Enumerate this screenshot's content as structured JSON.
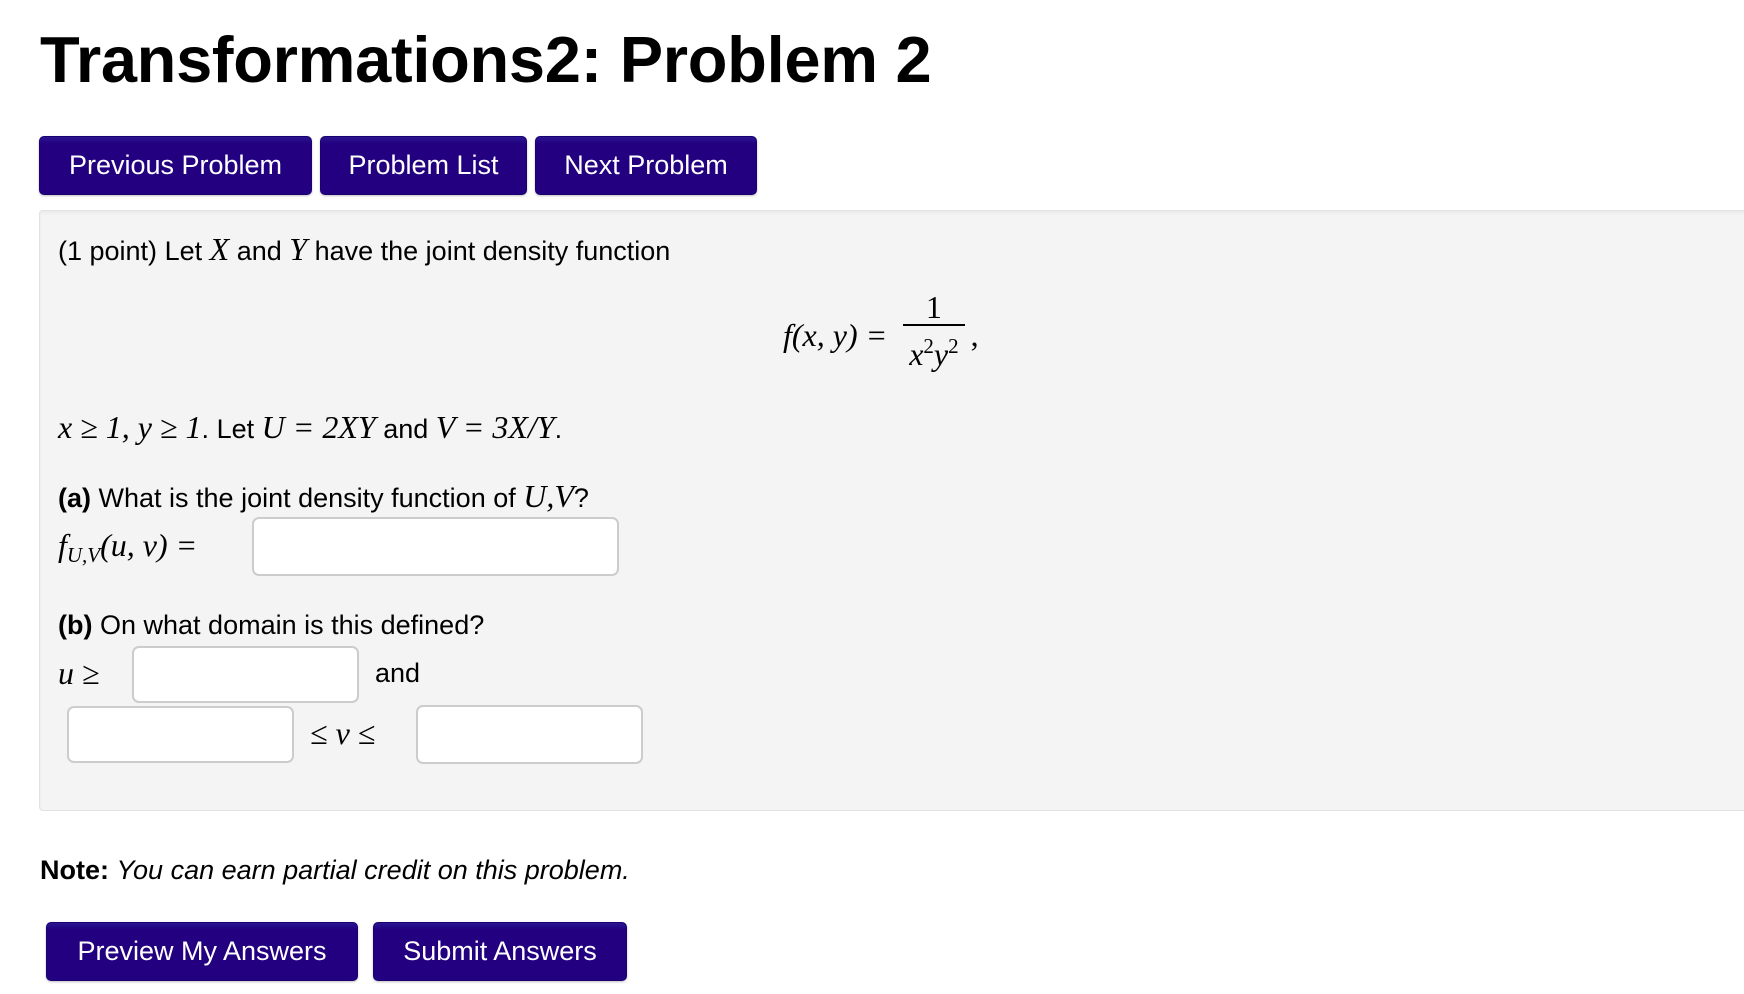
{
  "page": {
    "title": "Transformations2: Problem 2"
  },
  "nav": {
    "previous_label": "Previous Problem",
    "list_label": "Problem List",
    "next_label": "Next Problem"
  },
  "problem": {
    "points": "(1 point)",
    "intro_let": "Let",
    "var_X": "X",
    "and1": "and",
    "var_Y": "Y",
    "intro_rest": "have the joint density function",
    "formula": {
      "lhs": "f(x, y) =",
      "numerator": "1",
      "den_x": "x",
      "den_x_exp": "2",
      "den_y": "y",
      "den_y_exp": "2",
      "trailing": ","
    },
    "conditions": {
      "c1": "x ≥ 1, y ≥ 1",
      "period": ".",
      "let": "Let",
      "u_def": "U = 2XY",
      "and": "and",
      "v_def": "V = 3X/Y",
      "end": "."
    },
    "part_a": {
      "label": "(a)",
      "question": "What is the joint density function of",
      "vars": "U,V",
      "qmark": "?",
      "lhs_f": "f",
      "lhs_sub": "U,V",
      "lhs_args": "(u, v) =",
      "answer_value": ""
    },
    "part_b": {
      "label": "(b)",
      "question": "On what domain is this defined?",
      "u_ge": "u ≥",
      "and": "and",
      "le_v_le": "≤ v ≤",
      "u_lower_value": "",
      "v_lower_value": "",
      "v_upper_value": ""
    }
  },
  "note": {
    "label": "Note:",
    "text": "You can earn partial credit on this problem."
  },
  "actions": {
    "preview_label": "Preview My Answers",
    "submit_label": "Submit Answers"
  },
  "colors": {
    "button_bg": "#220080",
    "problem_bg": "#f4f4f4",
    "input_border": "#cccccc"
  }
}
